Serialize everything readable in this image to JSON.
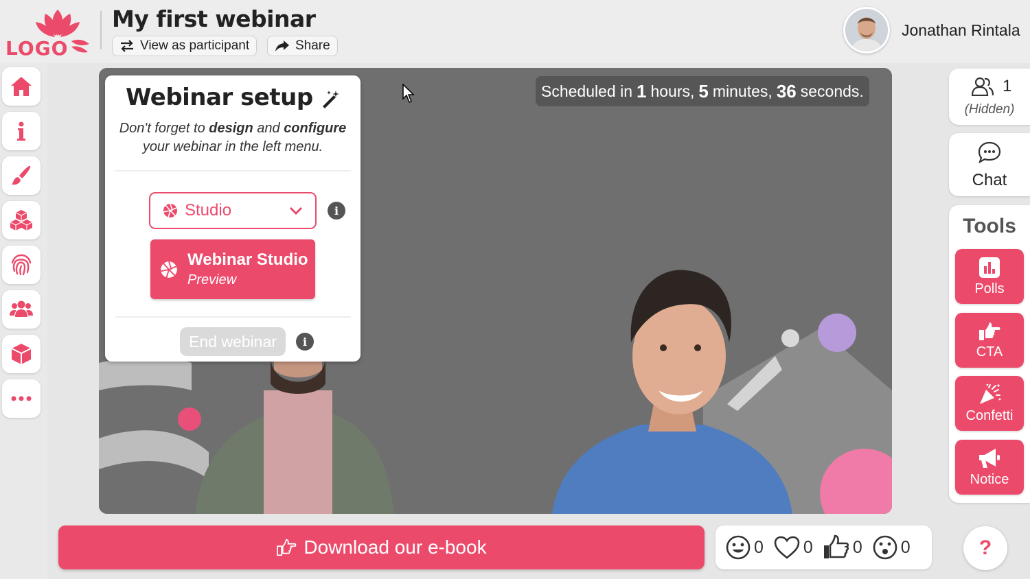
{
  "brand": {
    "logo_text": "LOGO",
    "accent": "#ec4a6b"
  },
  "header": {
    "title": "My first webinar",
    "view_as_participant": "View as participant",
    "share": "Share",
    "user_name": "Jonathan Rintala"
  },
  "sidebar": {
    "items": [
      {
        "icon": "home-icon"
      },
      {
        "icon": "info-icon"
      },
      {
        "icon": "brush-icon"
      },
      {
        "icon": "cubes-icon"
      },
      {
        "icon": "fingerprint-icon"
      },
      {
        "icon": "users-icon"
      },
      {
        "icon": "box-icon"
      },
      {
        "icon": "more-icon"
      }
    ]
  },
  "stage": {
    "schedule": {
      "prefix": "Scheduled in",
      "hours": "1",
      "hours_label": "hours,",
      "minutes": "5",
      "minutes_label": "minutes,",
      "seconds": "36",
      "seconds_label": "seconds."
    }
  },
  "setup": {
    "title": "Webinar setup",
    "desc_part1": "Don't forget to ",
    "desc_design": "design",
    "desc_and": " and ",
    "desc_configure": "configure",
    "desc_part2": "your webinar in the left menu.",
    "studio_select": "Studio",
    "studio_button_title": "Webinar Studio",
    "studio_button_sub": "Preview",
    "end_webinar": "End webinar"
  },
  "right_panel": {
    "viewers_count": "1",
    "viewers_status": "(Hidden)",
    "chat_label": "Chat",
    "tools_title": "Tools",
    "tools": [
      "Polls",
      "CTA",
      "Confetti",
      "Notice"
    ]
  },
  "bottom": {
    "cta_label": "Download our e-book",
    "reactions": [
      {
        "icon": "smile-icon",
        "count": "0"
      },
      {
        "icon": "heart-icon",
        "count": "0"
      },
      {
        "icon": "thumbs-up-icon",
        "count": "0"
      },
      {
        "icon": "surprised-icon",
        "count": "0"
      }
    ],
    "help": "?"
  }
}
